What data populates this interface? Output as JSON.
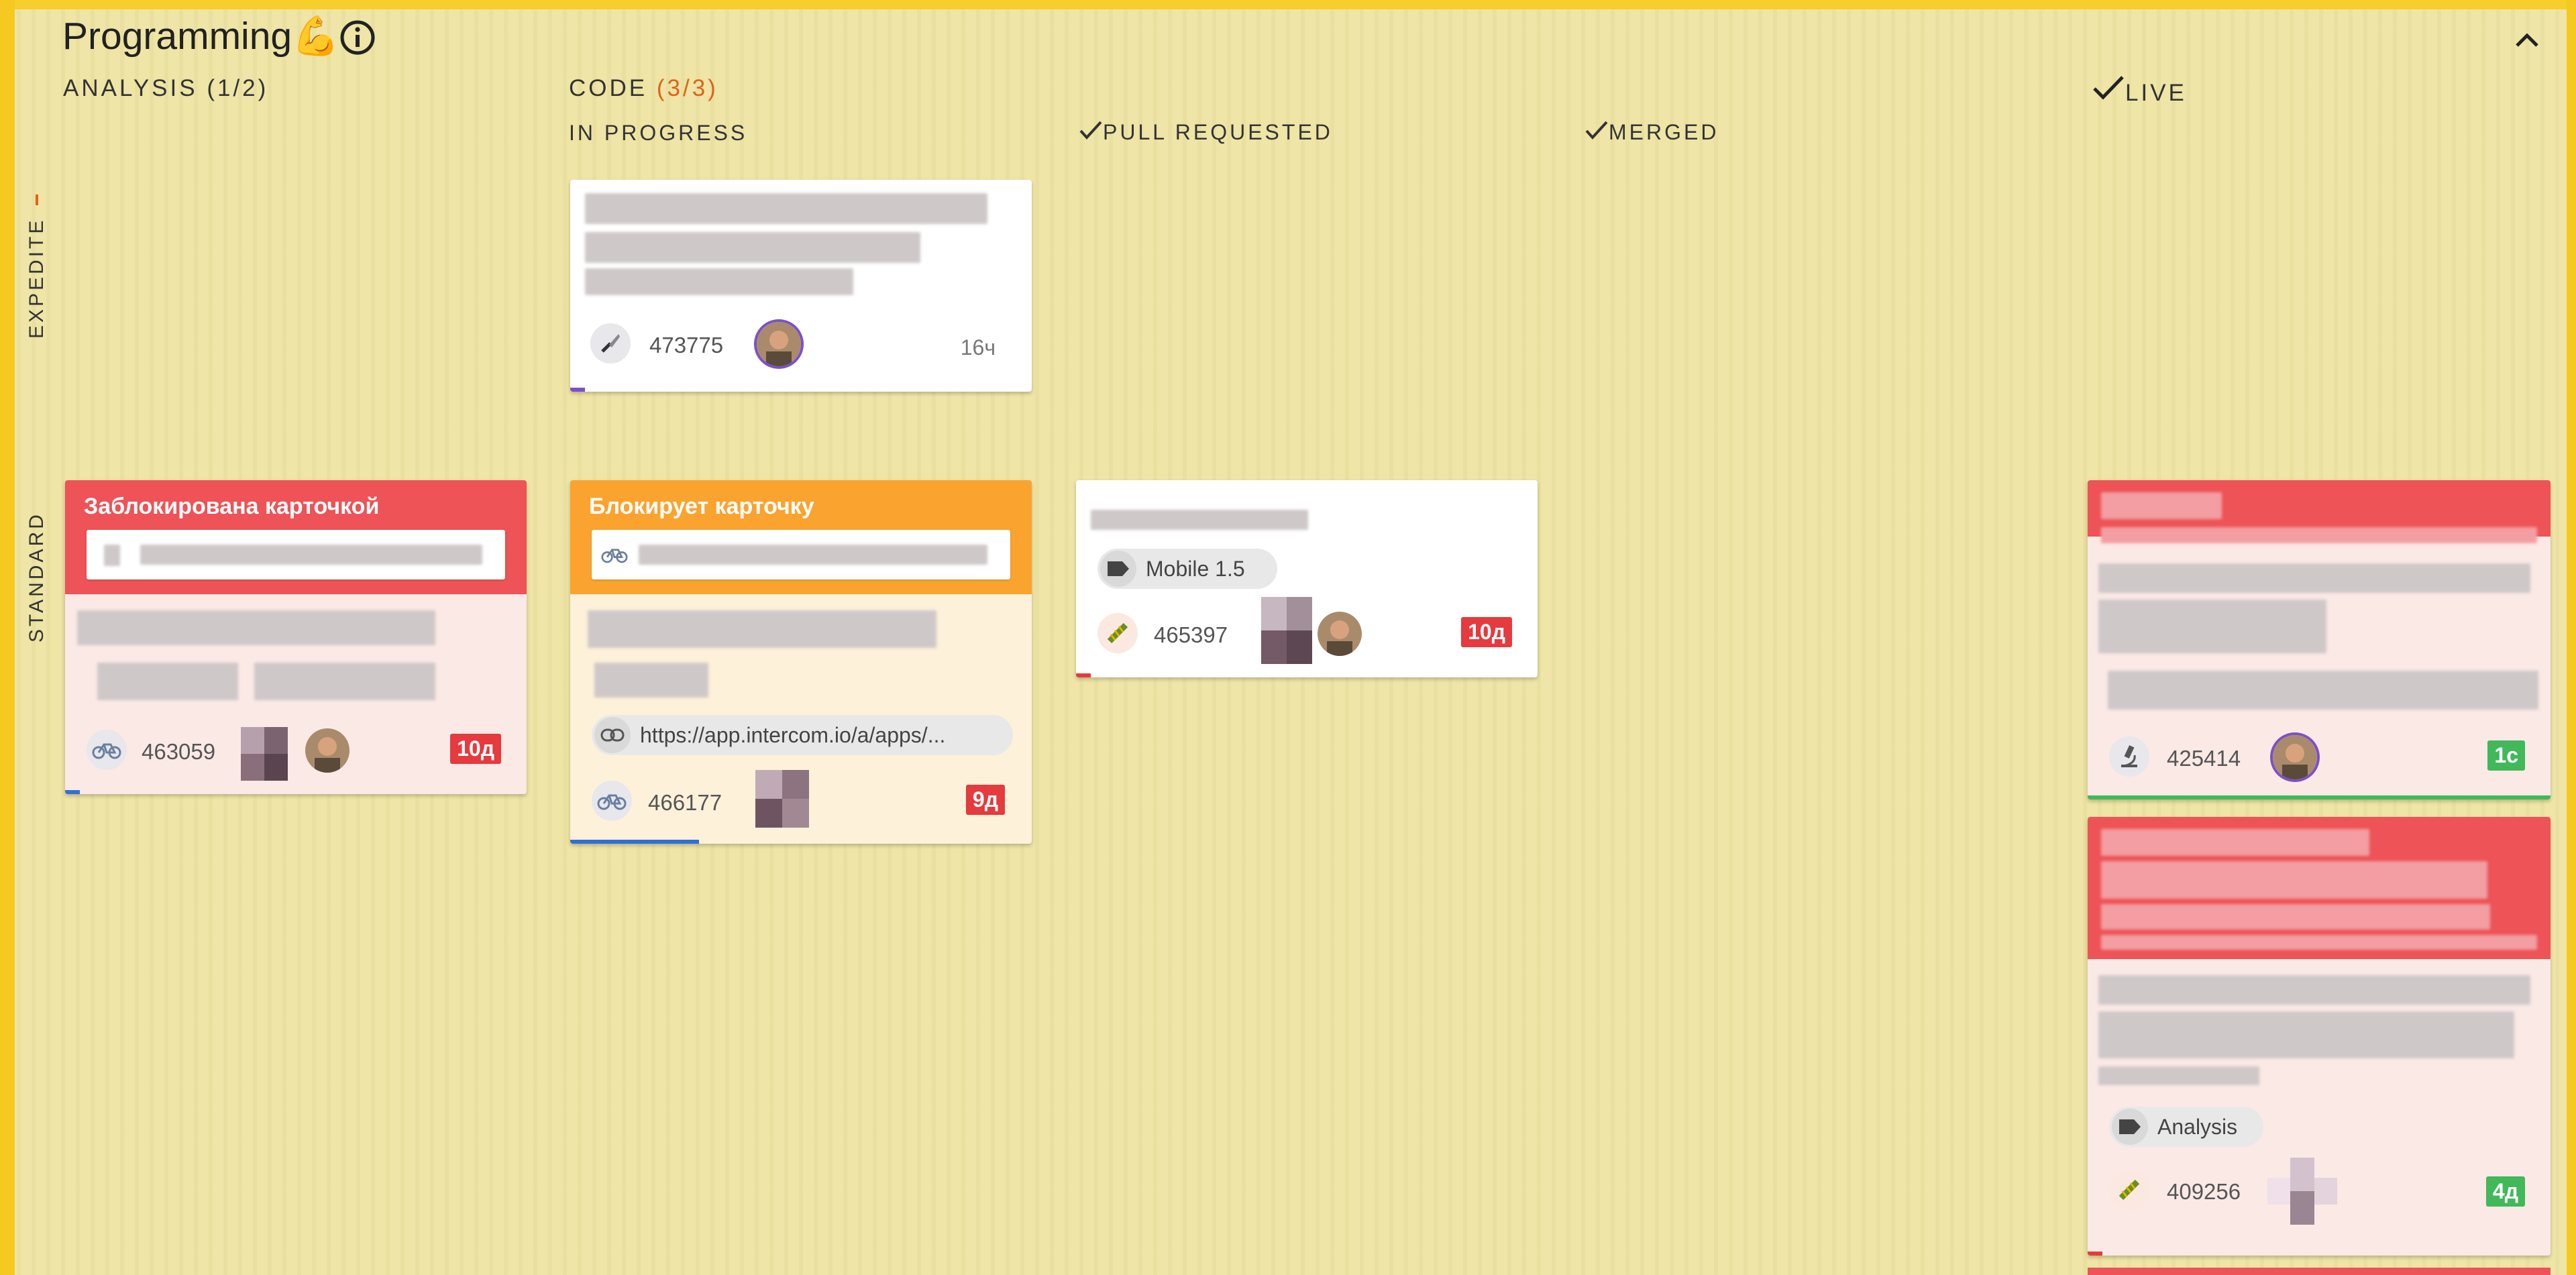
{
  "board": {
    "title": "Programming",
    "title_emoji": "💪",
    "info_icon": "info-circle-icon",
    "collapse_icon": "chevron-up-icon"
  },
  "columns": {
    "analysis": {
      "label": "ANALYSIS",
      "wip": "(1/2)"
    },
    "code": {
      "label": "CODE",
      "wip": "(3/3)"
    },
    "live": {
      "label": "LIVE",
      "check_icon": "check-icon"
    }
  },
  "subcolumns": {
    "in_progress": "IN PROGRESS",
    "pull_requested": "PULL REQUESTED",
    "merged": "MERGED"
  },
  "lanes": {
    "expedite": "EXPEDITE",
    "standard": "STANDARD"
  },
  "cards": {
    "c473775": {
      "id": "473775",
      "age": "16ч",
      "type_icon": "knife-icon"
    },
    "c463059": {
      "id": "463059",
      "age": "10д",
      "blocked_label": "Заблокирована карточкой",
      "type_icon": "bicycle-icon",
      "progress_color": "#2f6fd6"
    },
    "c466177": {
      "id": "466177",
      "age": "9д",
      "blocked_label": "Блокирует карточку",
      "link": "https://app.intercom.io/a/apps/...",
      "type_icon": "bicycle-icon",
      "progress_color": "#2f6fd6"
    },
    "c465397": {
      "id": "465397",
      "age": "10д",
      "tag": "Mobile 1.5",
      "type_icon": "bug-icon",
      "progress_color": "#e53a3e"
    },
    "c425414": {
      "id": "425414",
      "age": "1с",
      "type_icon": "microscope-icon",
      "progress_color": "#41b85a"
    },
    "c409256": {
      "id": "409256",
      "age": "4д",
      "tag": "Analysis",
      "type_icon": "bug-icon",
      "progress_color": "#e53a3e"
    }
  },
  "colors": {
    "board_bg": "#eee4a3",
    "border_yellow": "#f5c91f",
    "blocked_red": "#ed5357",
    "blocking_orange": "#fba32f",
    "wip_orange": "#e0621a",
    "age_red": "#e53a3e",
    "age_green": "#41b85a"
  }
}
